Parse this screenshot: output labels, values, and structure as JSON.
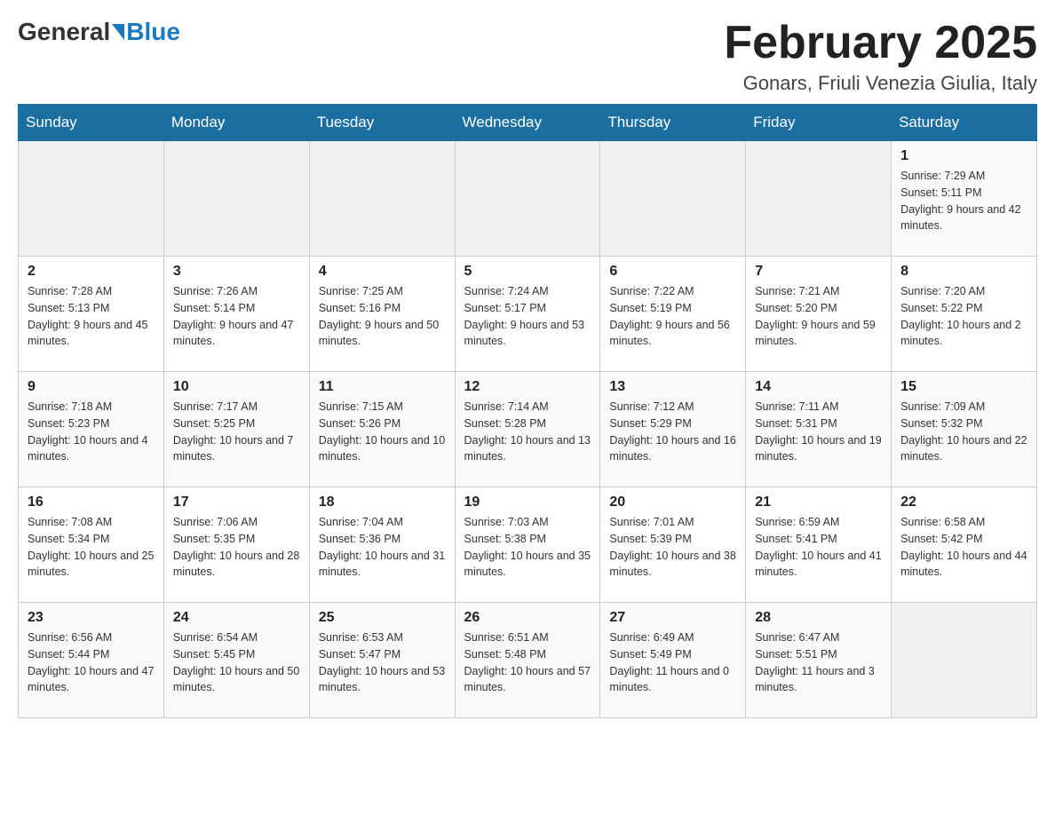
{
  "header": {
    "logo_general": "General",
    "logo_blue": "Blue",
    "month_title": "February 2025",
    "location": "Gonars, Friuli Venezia Giulia, Italy"
  },
  "weekdays": [
    "Sunday",
    "Monday",
    "Tuesday",
    "Wednesday",
    "Thursday",
    "Friday",
    "Saturday"
  ],
  "weeks": [
    [
      {
        "day": "",
        "info": ""
      },
      {
        "day": "",
        "info": ""
      },
      {
        "day": "",
        "info": ""
      },
      {
        "day": "",
        "info": ""
      },
      {
        "day": "",
        "info": ""
      },
      {
        "day": "",
        "info": ""
      },
      {
        "day": "1",
        "info": "Sunrise: 7:29 AM\nSunset: 5:11 PM\nDaylight: 9 hours and 42 minutes."
      }
    ],
    [
      {
        "day": "2",
        "info": "Sunrise: 7:28 AM\nSunset: 5:13 PM\nDaylight: 9 hours and 45 minutes."
      },
      {
        "day": "3",
        "info": "Sunrise: 7:26 AM\nSunset: 5:14 PM\nDaylight: 9 hours and 47 minutes."
      },
      {
        "day": "4",
        "info": "Sunrise: 7:25 AM\nSunset: 5:16 PM\nDaylight: 9 hours and 50 minutes."
      },
      {
        "day": "5",
        "info": "Sunrise: 7:24 AM\nSunset: 5:17 PM\nDaylight: 9 hours and 53 minutes."
      },
      {
        "day": "6",
        "info": "Sunrise: 7:22 AM\nSunset: 5:19 PM\nDaylight: 9 hours and 56 minutes."
      },
      {
        "day": "7",
        "info": "Sunrise: 7:21 AM\nSunset: 5:20 PM\nDaylight: 9 hours and 59 minutes."
      },
      {
        "day": "8",
        "info": "Sunrise: 7:20 AM\nSunset: 5:22 PM\nDaylight: 10 hours and 2 minutes."
      }
    ],
    [
      {
        "day": "9",
        "info": "Sunrise: 7:18 AM\nSunset: 5:23 PM\nDaylight: 10 hours and 4 minutes."
      },
      {
        "day": "10",
        "info": "Sunrise: 7:17 AM\nSunset: 5:25 PM\nDaylight: 10 hours and 7 minutes."
      },
      {
        "day": "11",
        "info": "Sunrise: 7:15 AM\nSunset: 5:26 PM\nDaylight: 10 hours and 10 minutes."
      },
      {
        "day": "12",
        "info": "Sunrise: 7:14 AM\nSunset: 5:28 PM\nDaylight: 10 hours and 13 minutes."
      },
      {
        "day": "13",
        "info": "Sunrise: 7:12 AM\nSunset: 5:29 PM\nDaylight: 10 hours and 16 minutes."
      },
      {
        "day": "14",
        "info": "Sunrise: 7:11 AM\nSunset: 5:31 PM\nDaylight: 10 hours and 19 minutes."
      },
      {
        "day": "15",
        "info": "Sunrise: 7:09 AM\nSunset: 5:32 PM\nDaylight: 10 hours and 22 minutes."
      }
    ],
    [
      {
        "day": "16",
        "info": "Sunrise: 7:08 AM\nSunset: 5:34 PM\nDaylight: 10 hours and 25 minutes."
      },
      {
        "day": "17",
        "info": "Sunrise: 7:06 AM\nSunset: 5:35 PM\nDaylight: 10 hours and 28 minutes."
      },
      {
        "day": "18",
        "info": "Sunrise: 7:04 AM\nSunset: 5:36 PM\nDaylight: 10 hours and 31 minutes."
      },
      {
        "day": "19",
        "info": "Sunrise: 7:03 AM\nSunset: 5:38 PM\nDaylight: 10 hours and 35 minutes."
      },
      {
        "day": "20",
        "info": "Sunrise: 7:01 AM\nSunset: 5:39 PM\nDaylight: 10 hours and 38 minutes."
      },
      {
        "day": "21",
        "info": "Sunrise: 6:59 AM\nSunset: 5:41 PM\nDaylight: 10 hours and 41 minutes."
      },
      {
        "day": "22",
        "info": "Sunrise: 6:58 AM\nSunset: 5:42 PM\nDaylight: 10 hours and 44 minutes."
      }
    ],
    [
      {
        "day": "23",
        "info": "Sunrise: 6:56 AM\nSunset: 5:44 PM\nDaylight: 10 hours and 47 minutes."
      },
      {
        "day": "24",
        "info": "Sunrise: 6:54 AM\nSunset: 5:45 PM\nDaylight: 10 hours and 50 minutes."
      },
      {
        "day": "25",
        "info": "Sunrise: 6:53 AM\nSunset: 5:47 PM\nDaylight: 10 hours and 53 minutes."
      },
      {
        "day": "26",
        "info": "Sunrise: 6:51 AM\nSunset: 5:48 PM\nDaylight: 10 hours and 57 minutes."
      },
      {
        "day": "27",
        "info": "Sunrise: 6:49 AM\nSunset: 5:49 PM\nDaylight: 11 hours and 0 minutes."
      },
      {
        "day": "28",
        "info": "Sunrise: 6:47 AM\nSunset: 5:51 PM\nDaylight: 11 hours and 3 minutes."
      },
      {
        "day": "",
        "info": ""
      }
    ]
  ]
}
